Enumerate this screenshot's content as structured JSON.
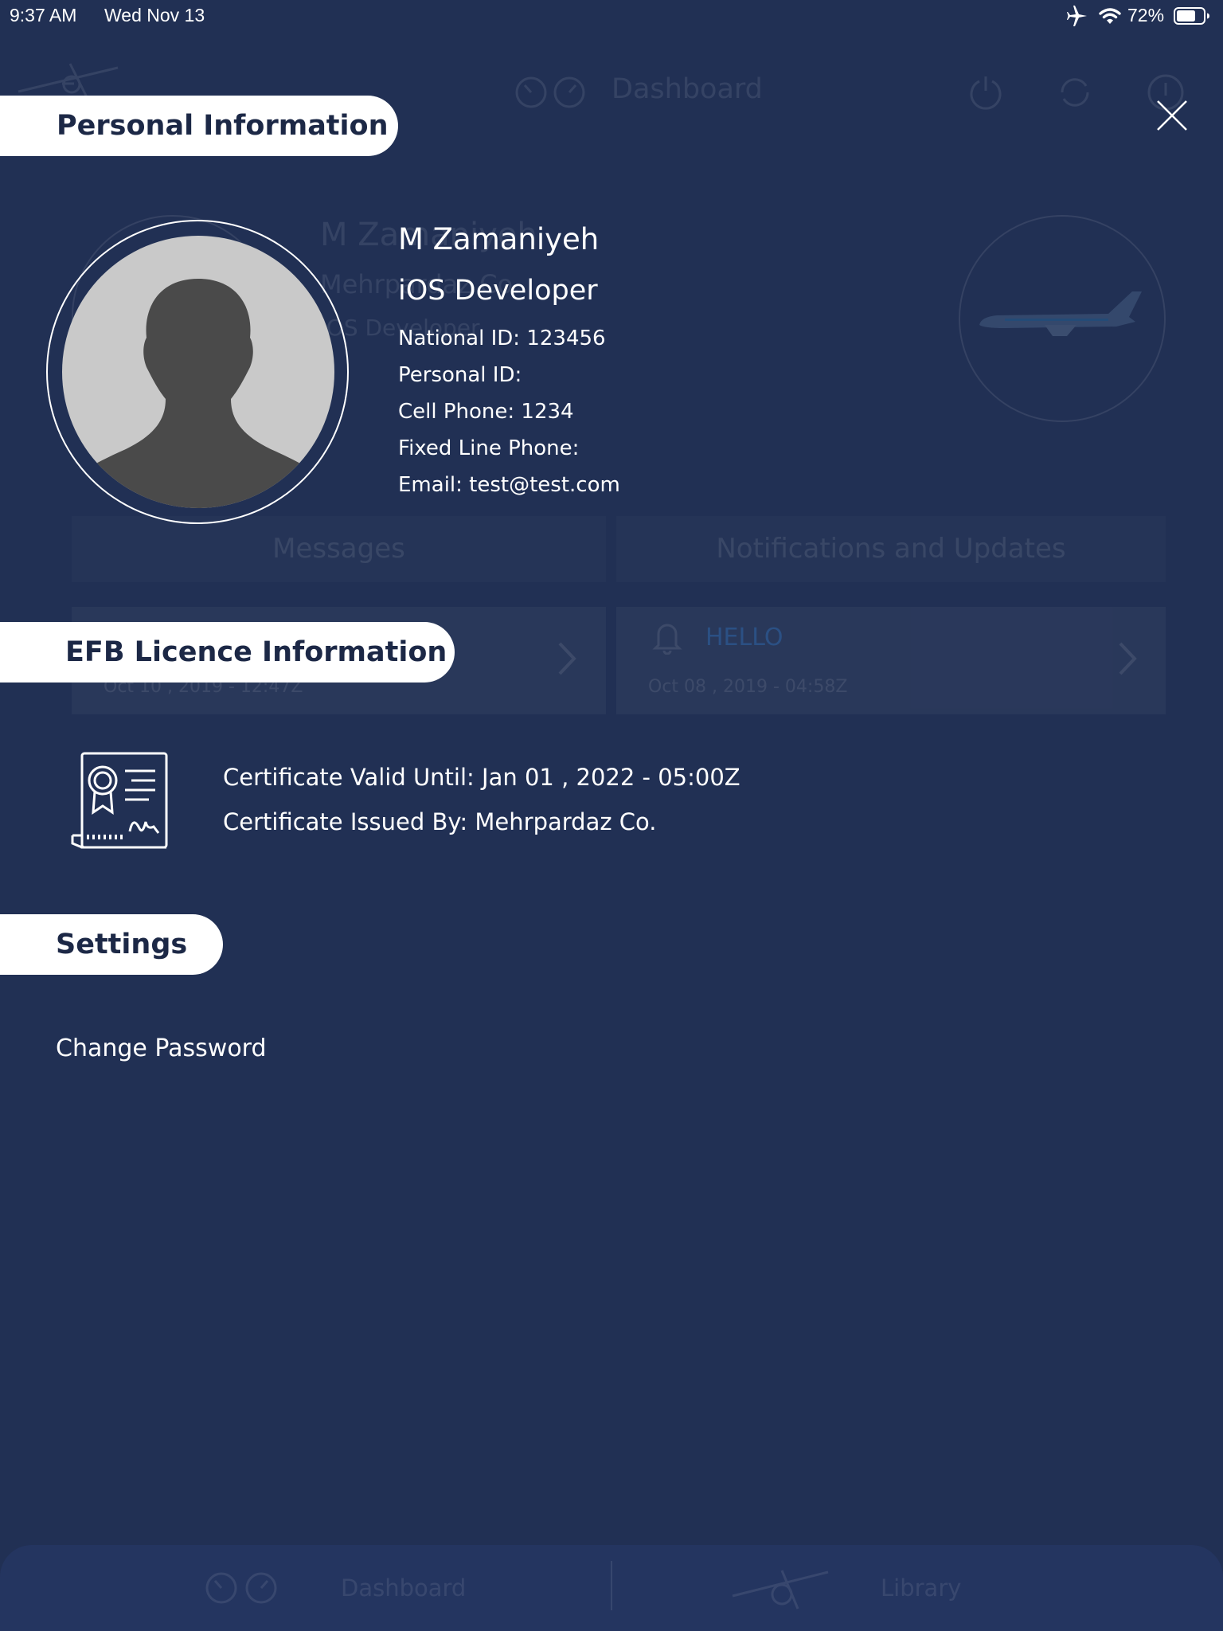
{
  "status_bar": {
    "time": "9:37 AM",
    "date": "Wed Nov 13",
    "battery": "72%",
    "battery_level": 0.72,
    "icons": [
      "airplane-mode-icon",
      "wifi-icon",
      "battery-icon"
    ]
  },
  "background": {
    "header_title": "Dashboard",
    "profile_name": "M Zamaniyeh",
    "profile_company": "Mehrpardaz Co.",
    "profile_role": "iOS Developer",
    "messages_tab": "Messages",
    "notifications_tab": "Notifications and Updates",
    "message_card_date": "Oct 10 , 2019 - 12:47Z",
    "notification_card_title": "HELLO",
    "notification_card_date": "Oct 08 , 2019 - 04:58Z",
    "tabbar_dashboard": "Dashboard",
    "tabbar_library": "Library"
  },
  "personal": {
    "section_title": "Personal Information",
    "name": "M Zamaniyeh",
    "role": "iOS Developer",
    "national_id": "National ID: 123456",
    "personal_id": "Personal ID:",
    "cell_phone": "Cell Phone: 1234",
    "fixed_line": "Fixed Line Phone:",
    "email": "Email: test@test.com"
  },
  "licence": {
    "section_title": "EFB Licence Information",
    "valid_until": "Certificate Valid Until: Jan 01 , 2022 - 05:00Z",
    "issued_by": "Certificate Issued By: Mehrpardaz Co."
  },
  "settings": {
    "section_title": "Settings",
    "change_password": "Change Password"
  },
  "colors": {
    "overlay_background": "#213054",
    "pill_background": "#ffffff",
    "pill_text": "#1c2846",
    "avatar_background": "#c9c9c9",
    "avatar_silhouette": "#4a4a4a"
  }
}
